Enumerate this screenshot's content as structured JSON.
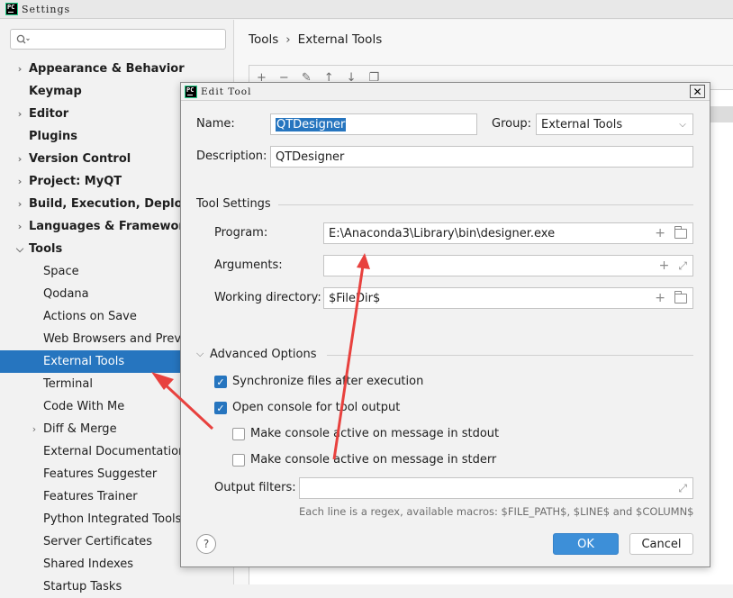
{
  "settings_window": {
    "title": "Settings",
    "search": {
      "placeholder": "",
      "value": ""
    },
    "tree": [
      {
        "label": "Appearance & Behavior",
        "level": 0,
        "expandable": true,
        "expanded": false,
        "bold": true
      },
      {
        "label": "Keymap",
        "level": 0,
        "expandable": false,
        "bold": true
      },
      {
        "label": "Editor",
        "level": 0,
        "expandable": true,
        "expanded": false,
        "bold": true
      },
      {
        "label": "Plugins",
        "level": 0,
        "expandable": false,
        "bold": true
      },
      {
        "label": "Version Control",
        "level": 0,
        "expandable": true,
        "expanded": false,
        "bold": true
      },
      {
        "label": "Project: MyQT",
        "level": 0,
        "expandable": true,
        "expanded": false,
        "bold": true
      },
      {
        "label": "Build, Execution, Deployment",
        "level": 0,
        "expandable": true,
        "expanded": false,
        "bold": true
      },
      {
        "label": "Languages & Frameworks",
        "level": 0,
        "expandable": true,
        "expanded": false,
        "bold": true
      },
      {
        "label": "Tools",
        "level": 0,
        "expandable": true,
        "expanded": true,
        "bold": true
      },
      {
        "label": "Space",
        "level": 1,
        "expandable": false
      },
      {
        "label": "Qodana",
        "level": 1,
        "expandable": false
      },
      {
        "label": "Actions on Save",
        "level": 1,
        "expandable": false
      },
      {
        "label": "Web Browsers and Preview",
        "level": 1,
        "expandable": false
      },
      {
        "label": "External Tools",
        "level": 1,
        "expandable": false,
        "selected": true
      },
      {
        "label": "Terminal",
        "level": 1,
        "expandable": false
      },
      {
        "label": "Code With Me",
        "level": 1,
        "expandable": false
      },
      {
        "label": "Diff & Merge",
        "level": 1,
        "expandable": true,
        "expanded": false
      },
      {
        "label": "External Documentation",
        "level": 1,
        "expandable": false
      },
      {
        "label": "Features Suggester",
        "level": 1,
        "expandable": false
      },
      {
        "label": "Features Trainer",
        "level": 1,
        "expandable": false
      },
      {
        "label": "Python Integrated Tools",
        "level": 1,
        "expandable": false
      },
      {
        "label": "Server Certificates",
        "level": 1,
        "expandable": false
      },
      {
        "label": "Shared Indexes",
        "level": 1,
        "expandable": false
      },
      {
        "label": "Startup Tasks",
        "level": 1,
        "expandable": false
      }
    ],
    "breadcrumb": {
      "parent": "Tools",
      "separator": "›",
      "current": "External Tools"
    },
    "toolbar_icons": [
      "add-icon",
      "remove-icon",
      "edit-icon",
      "move-up-icon",
      "move-down-icon",
      "copy-icon"
    ]
  },
  "edit_tool_dialog": {
    "title": "Edit Tool",
    "name_label": "Name:",
    "name_value": "QTDesigner",
    "group_label": "Group:",
    "group_value": "External Tools",
    "description_label": "Description:",
    "description_value": "QTDesigner",
    "tool_settings_header": "Tool Settings",
    "program_label": "Program:",
    "program_value": "E:\\Anaconda3\\Library\\bin\\designer.exe",
    "arguments_label": "Arguments:",
    "arguments_value": "",
    "working_dir_label": "Working directory:",
    "working_dir_value": "$FileDir$",
    "advanced_header": "Advanced Options",
    "options": [
      {
        "label": "Synchronize files after execution",
        "checked": true,
        "indent": 0
      },
      {
        "label": "Open console for tool output",
        "checked": true,
        "indent": 0
      },
      {
        "label": "Make console active on message in stdout",
        "checked": false,
        "indent": 1
      },
      {
        "label": "Make console active on message in stderr",
        "checked": false,
        "indent": 1
      }
    ],
    "output_filters_label": "Output filters:",
    "output_filters_value": "",
    "macros_hint": "Each line is a regex, available macros: $FILE_PATH$, $LINE$ and $COLUMN$",
    "help_label": "?",
    "ok_label": "OK",
    "cancel_label": "Cancel"
  },
  "colors": {
    "selection": "#2675bf",
    "annotation_arrow": "#e8413e",
    "ok_button": "#3d8fd8"
  }
}
